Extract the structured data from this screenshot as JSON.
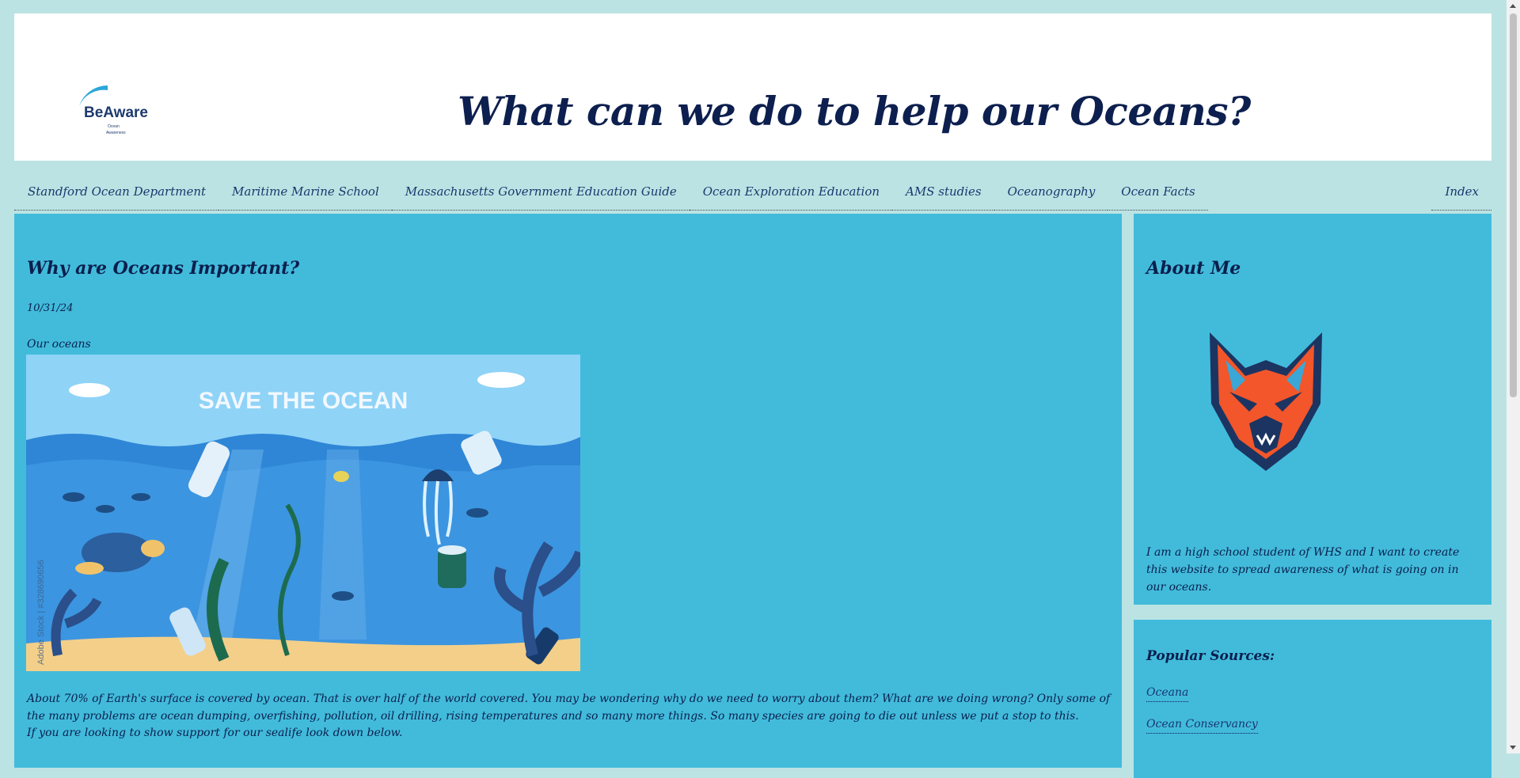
{
  "header": {
    "logo_text": "BeAware",
    "logo_subtext": "Ocean Awareness",
    "title": "What can we do to help our Oceans?"
  },
  "nav": {
    "items": [
      {
        "label": "Standford Ocean Department"
      },
      {
        "label": "Maritime Marine School"
      },
      {
        "label": "Massachusetts Government Education Guide"
      },
      {
        "label": "Ocean Exploration Education"
      },
      {
        "label": "AMS studies"
      },
      {
        "label": "Oceanography"
      },
      {
        "label": "Ocean Facts"
      }
    ],
    "right_item": "Index"
  },
  "post": {
    "title": "Why are Oceans Important?",
    "date": "10/31/24",
    "intro": "Our oceans",
    "image_caption": "SAVE THE OCEAN",
    "image_watermark": "Adobe Stock | #328690656",
    "body": "About 70% of Earth's surface is covered by ocean. That is over half of the world covered. You may be wondering why do we need to worry about them? What are we doing wrong? Only some of the many problems are ocean dumping, overfishing, pollution, oil drilling, rising temperatures and so many more things. So many species are going to die out unless we put a stop to this.",
    "support": "If you are looking to show support for our sealife look down below."
  },
  "about": {
    "title": "About Me",
    "mascot_icon": "wolf-mascot-icon",
    "text": "I am a high school student of WHS and I want to create this website to spread awareness of what is going on in our oceans."
  },
  "sources": {
    "title": "Popular Sources:",
    "links": [
      {
        "label": "Oceana"
      },
      {
        "label": "Ocean Conservancy"
      }
    ]
  },
  "colors": {
    "background": "#bce3e3",
    "panel": "#42bbdb",
    "text": "#0a1f4d",
    "header_bg": "#ffffff"
  }
}
